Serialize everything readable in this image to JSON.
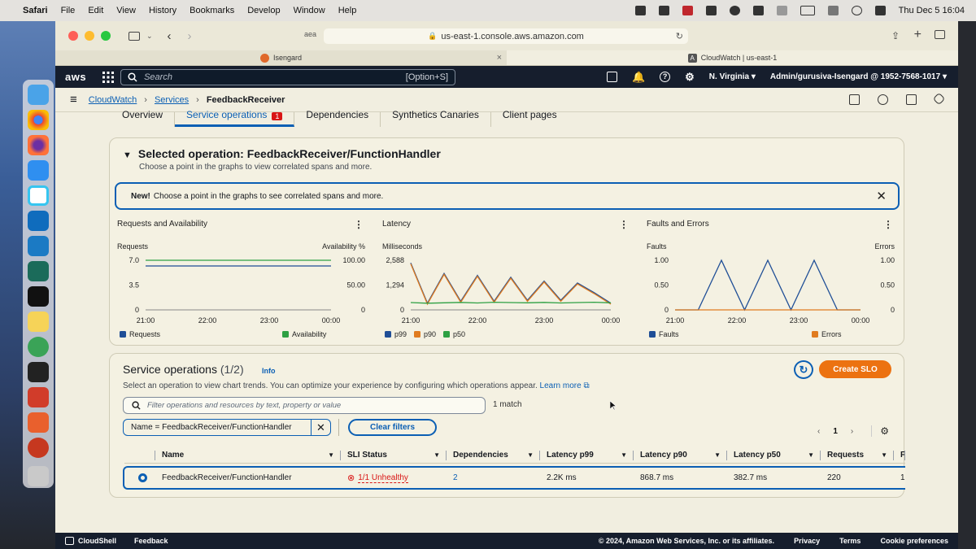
{
  "menubar": {
    "apple": "",
    "app": "Safari",
    "items": [
      "File",
      "Edit",
      "View",
      "History",
      "Bookmarks",
      "Develop",
      "Window",
      "Help"
    ],
    "clock": "Thu Dec 5  16:04"
  },
  "browser": {
    "url": "us-east-1.console.aws.amazon.com",
    "aea": "aea",
    "tabs": [
      {
        "label": "Isengard"
      },
      {
        "label": "CloudWatch | us-east-1"
      }
    ]
  },
  "aws": {
    "logo": "aws",
    "search_placeholder": "Search",
    "search_shortcut": "[Option+S]",
    "region": "N. Virginia",
    "account": "Admin/gurusiva-Isengard @ 1952-7568-1017"
  },
  "breadcrumb": [
    "CloudWatch",
    "Services",
    "FeedbackReceiver"
  ],
  "tabs": [
    {
      "label": "Overview"
    },
    {
      "label": "Service operations",
      "badge": "1"
    },
    {
      "label": "Dependencies"
    },
    {
      "label": "Synthetics Canaries"
    },
    {
      "label": "Client pages"
    }
  ],
  "selected": {
    "title": "Selected operation: FeedbackReceiver/FunctionHandler",
    "subtitle": "Choose a point in the graphs to view correlated spans and more.",
    "flash_bold": "New!",
    "flash_text": "Choose a point in the graphs to see correlated spans and more."
  },
  "charts": [
    {
      "title": "Requests and Availability",
      "left_label": "Requests",
      "right_label": "Availability %",
      "left_ticks": [
        "7.0",
        "3.5",
        "0"
      ],
      "right_ticks": [
        "100.00",
        "50.00",
        "0"
      ],
      "x_ticks": [
        "21:00",
        "22:00",
        "23:00",
        "00:00"
      ],
      "legend": [
        {
          "name": "Requests",
          "color": "#1f4e96"
        },
        {
          "name": "Availability",
          "color": "#2ea043"
        }
      ]
    },
    {
      "title": "Latency",
      "left_label": "Milliseconds",
      "left_ticks": [
        "2,588",
        "1,294",
        "0"
      ],
      "x_ticks": [
        "21:00",
        "22:00",
        "23:00",
        "00:00"
      ],
      "legend": [
        {
          "name": "p99",
          "color": "#1f4e96"
        },
        {
          "name": "p90",
          "color": "#e07b1f"
        },
        {
          "name": "p50",
          "color": "#2ea043"
        }
      ]
    },
    {
      "title": "Faults and Errors",
      "left_label": "Faults",
      "right_label": "Errors",
      "left_ticks": [
        "1.00",
        "0.50",
        "0"
      ],
      "right_ticks": [
        "1.00",
        "0.50",
        "0"
      ],
      "x_ticks": [
        "21:00",
        "22:00",
        "23:00",
        "00:00"
      ],
      "legend": [
        {
          "name": "Faults",
          "color": "#1f4e96"
        },
        {
          "name": "Errors",
          "color": "#e07b1f"
        }
      ]
    }
  ],
  "chart_data": [
    {
      "type": "line",
      "title": "Requests and Availability",
      "x": [
        "21:00",
        "21:15",
        "21:30",
        "21:45",
        "22:00",
        "22:15",
        "22:30",
        "22:45",
        "23:00",
        "23:15",
        "23:30",
        "23:45",
        "00:00"
      ],
      "ylim": [
        0,
        7
      ],
      "y2lim": [
        0,
        100
      ],
      "series": [
        {
          "name": "Requests",
          "values": [
            6.2,
            6.2,
            6.2,
            6.2,
            6.2,
            6.2,
            6.2,
            6.2,
            6.2,
            6.2,
            6.2,
            6.2,
            6.2
          ],
          "axis": "left"
        },
        {
          "name": "Availability",
          "values": [
            100,
            100,
            100,
            100,
            100,
            100,
            100,
            100,
            100,
            100,
            100,
            100,
            100
          ],
          "axis": "right"
        }
      ]
    },
    {
      "type": "line",
      "title": "Latency",
      "x": [
        "21:00",
        "21:15",
        "21:30",
        "21:45",
        "22:00",
        "22:15",
        "22:30",
        "22:45",
        "23:00",
        "23:15",
        "23:30",
        "23:45",
        "00:00"
      ],
      "ylim": [
        0,
        2588
      ],
      "series": [
        {
          "name": "p99",
          "values": [
            2450,
            350,
            1900,
            450,
            1800,
            450,
            1700,
            500,
            1500,
            500,
            1400,
            900,
            350
          ]
        },
        {
          "name": "p90",
          "values": [
            2400,
            300,
            1850,
            400,
            1750,
            400,
            1650,
            450,
            1450,
            450,
            1350,
            850,
            300
          ]
        },
        {
          "name": "p50",
          "values": [
            380,
            350,
            370,
            390,
            360,
            400,
            380,
            370,
            390,
            360,
            380,
            400,
            370
          ]
        }
      ]
    },
    {
      "type": "line",
      "title": "Faults and Errors",
      "x": [
        "21:00",
        "21:30",
        "22:00",
        "22:30",
        "23:00",
        "23:30",
        "00:00"
      ],
      "ylim": [
        0,
        1
      ],
      "y2lim": [
        0,
        1
      ],
      "series": [
        {
          "name": "Faults",
          "values": [
            0,
            0,
            1,
            0,
            1,
            0,
            1,
            0,
            0
          ],
          "axis": "left"
        },
        {
          "name": "Errors",
          "values": [
            0,
            0,
            0,
            0,
            0,
            0,
            0,
            0,
            0
          ],
          "axis": "right"
        }
      ]
    }
  ],
  "svc": {
    "title": "Service operations",
    "count": "(1/2)",
    "info": "Info",
    "desc": "Select an operation to view chart trends. You can optimize your experience by configuring which operations appear.",
    "learn_more": "Learn more",
    "create_slo": "Create SLO",
    "filter_placeholder": "Filter operations and resources by text, property or value",
    "match": "1 match",
    "token": "Name = FeedbackReceiver/FunctionHandler",
    "clear": "Clear filters",
    "page": "1",
    "columns": [
      "Name",
      "SLI Status",
      "Dependencies",
      "Latency p99",
      "Latency p90",
      "Latency p50",
      "Requests",
      "F"
    ],
    "row": {
      "name": "FeedbackReceiver/FunctionHandler",
      "sli": "1/1 Unhealthy",
      "deps": "2",
      "p99": "2.2K ms",
      "p90": "868.7 ms",
      "p50": "382.7 ms",
      "requests": "220",
      "f": "1"
    }
  },
  "footer": {
    "cloudshell": "CloudShell",
    "feedback": "Feedback",
    "copyright": "© 2024, Amazon Web Services, Inc. or its affiliates.",
    "privacy": "Privacy",
    "terms": "Terms",
    "cookies": "Cookie preferences"
  }
}
